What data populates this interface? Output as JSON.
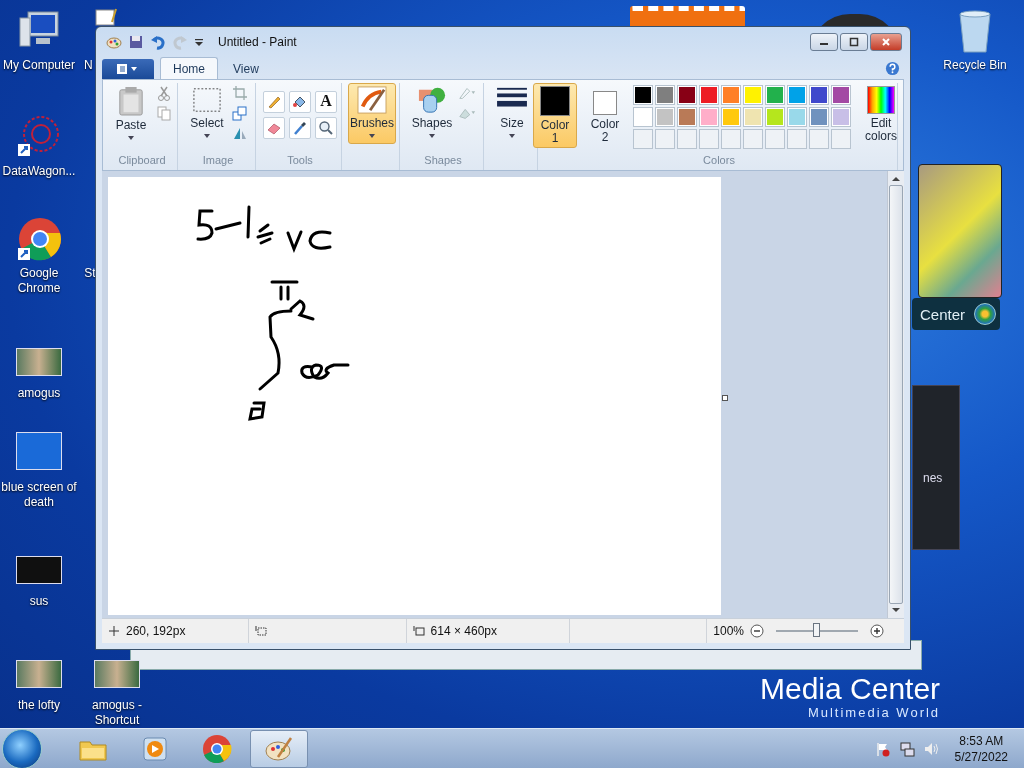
{
  "desktop": {
    "icons": [
      {
        "label": "My Computer",
        "kind": "computer"
      },
      {
        "label": "N",
        "kind": "notepad"
      },
      {
        "label": "DataWagon...",
        "kind": "star-shortcut"
      },
      {
        "label": "Google Chrome",
        "kind": "chrome-shortcut"
      },
      {
        "label": "St",
        "kind": "none"
      },
      {
        "label": "amogus",
        "kind": "photo"
      },
      {
        "label": "blue screen of death",
        "kind": "blue-screen"
      },
      {
        "label": "sus",
        "kind": "video"
      },
      {
        "label": "the lofty",
        "kind": "photo"
      },
      {
        "label": "amogus - Shortcut",
        "kind": "photo-shortcut"
      },
      {
        "label": "Recycle Bin",
        "kind": "bin"
      }
    ],
    "wallpaper": {
      "title": "Media Center",
      "subtitle": "Multimedia World"
    },
    "gadget": {
      "label": "Center",
      "panel_text": "nes"
    }
  },
  "window": {
    "title": "Untitled - Paint",
    "tabs": [
      {
        "label": "Home",
        "selected": true
      },
      {
        "label": "View",
        "selected": false
      }
    ],
    "ribbon": {
      "clipboard": {
        "label": "Clipboard",
        "paste": "Paste"
      },
      "image": {
        "label": "Image",
        "select": "Select"
      },
      "tools": {
        "label": "Tools",
        "text_tool": "A"
      },
      "brushes": {
        "label": "Brushes",
        "active": true
      },
      "shapes": {
        "label": "Shapes",
        "button": "Shapes"
      },
      "size": {
        "label": "Size"
      },
      "colors": {
        "label": "Colors",
        "color1": {
          "label": "Color 1",
          "color": "#000000",
          "selected": true
        },
        "color2": {
          "label": "Color 2",
          "color": "#ffffff",
          "selected": false
        },
        "palette": [
          {
            "color": "#000000"
          },
          {
            "color": "#7f7f7f"
          },
          {
            "color": "#880015"
          },
          {
            "color": "#ed1c24"
          },
          {
            "color": "#ff7f27"
          },
          {
            "color": "#fff200"
          },
          {
            "color": "#22b14c"
          },
          {
            "color": "#00a2e8"
          },
          {
            "color": "#3f48cc"
          },
          {
            "color": "#a349a4"
          },
          {
            "color": "#ffffff"
          },
          {
            "color": "#c3c3c3"
          },
          {
            "color": "#b97a57"
          },
          {
            "color": "#ffaec9"
          },
          {
            "color": "#ffc90e"
          },
          {
            "color": "#efe4b0"
          },
          {
            "color": "#b5e61d"
          },
          {
            "color": "#99d9ea"
          },
          {
            "color": "#7092be"
          },
          {
            "color": "#c8bfe7"
          }
        ],
        "edit": "Edit colors"
      }
    },
    "status_bar": {
      "position": "260, 192px",
      "canvas_size": "614 × 460px",
      "zoom": "100%",
      "zoom_slider": {
        "level": 0.5
      }
    }
  },
  "taskbar": {
    "items": [
      {
        "kind": "explorer",
        "selected": false
      },
      {
        "kind": "media-player",
        "selected": false
      },
      {
        "kind": "chrome",
        "selected": false
      },
      {
        "kind": "paint",
        "selected": true
      }
    ],
    "time": "8:53 AM",
    "date": "5/27/2022"
  }
}
